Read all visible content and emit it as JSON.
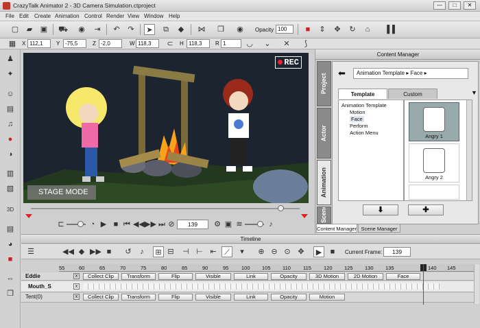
{
  "window": {
    "title": "CrazyTalk Animator 2 - 3D Camera Simulation.ctproject",
    "min": "—",
    "max": "□",
    "close": "✕"
  },
  "menu": [
    "File",
    "Edit",
    "Create",
    "Animation",
    "Control",
    "Render",
    "View",
    "Window",
    "Help"
  ],
  "toolbar": {
    "opacity_label": "Opacity :",
    "opacity_value": "100"
  },
  "transform": {
    "x_label": "X",
    "x": "112,1",
    "y_label": "Y",
    "y": "-75,5",
    "z_label": "Z",
    "z": "-2,0",
    "w_label": "W",
    "w": "118,3",
    "h_label": "H",
    "h": "118,3",
    "r_label": "R",
    "r": "1"
  },
  "stage": {
    "rec": "REC",
    "mode": "STAGE MODE"
  },
  "playback": {
    "frame": "139"
  },
  "content_manager": {
    "title": "Content Manager",
    "path": "Animation Template ▸ Face ▸",
    "tabs": {
      "template": "Template",
      "custom": "Custom"
    },
    "vtabs": [
      "Project",
      "Actor",
      "Animation",
      "Scene"
    ],
    "tree": [
      "Animation Template",
      "Motion",
      "Face",
      "Perform",
      "Action Menu"
    ],
    "thumbs": [
      "Angry 1",
      "Angry 2"
    ],
    "bottom_tabs": [
      "Content Manager",
      "Scene Manager"
    ]
  },
  "timeline": {
    "title": "Timeline",
    "current_frame_label": "Current Frame:",
    "current_frame": "139",
    "ruler": [
      "55",
      "60",
      "65",
      "70",
      "75",
      "80",
      "85",
      "90",
      "95",
      "100",
      "105",
      "110",
      "115",
      "120",
      "125",
      "130",
      "135",
      "140",
      "145"
    ],
    "tracks": [
      {
        "name": "Eddie",
        "buttons": [
          "Collect Clip",
          "Transform",
          "Flip",
          "Visible",
          "Link",
          "Opacity",
          "3D Motion",
          "2D Motion",
          "Face"
        ]
      },
      {
        "name": "Mouth_S",
        "buttons": []
      },
      {
        "name": "Tent(0)",
        "buttons": [
          "Collect Clip",
          "Transform",
          "Flip",
          "Visible",
          "Link",
          "Opacity",
          "Motion"
        ]
      }
    ]
  },
  "colors": {
    "accent": "#d22222",
    "stage_bg": "#1c2430",
    "rec_dot": "#e23"
  }
}
